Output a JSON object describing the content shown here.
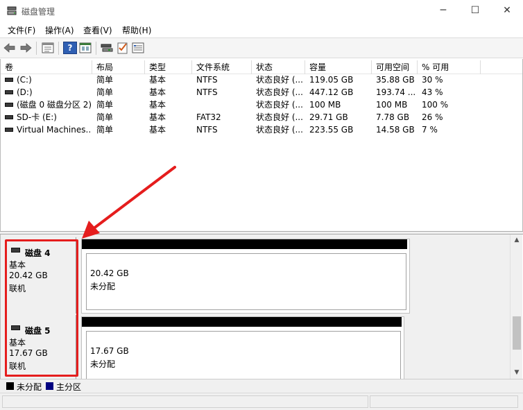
{
  "window": {
    "title": "磁盘管理",
    "minimize_glyph": "─",
    "maximize_glyph": "☐",
    "close_glyph": "✕"
  },
  "menu": [
    {
      "label": "文件(F)"
    },
    {
      "label": "操作(A)"
    },
    {
      "label": "查看(V)"
    },
    {
      "label": "帮助(H)"
    }
  ],
  "toolbar": {
    "icons": [
      "back-arrow-icon",
      "forward-arrow-icon",
      "console-view-icon",
      "help-icon",
      "properties-view-icon",
      "connect-icon",
      "checklist-icon",
      "settings-list-icon"
    ],
    "help_glyph": "?"
  },
  "volume_list": {
    "columns": [
      "卷",
      "布局",
      "类型",
      "文件系统",
      "状态",
      "容量",
      "可用空间",
      "% 可用"
    ],
    "rows": [
      {
        "name": "(C:)",
        "layout": "简单",
        "type": "基本",
        "fs": "NTFS",
        "status": "状态良好 (...",
        "capacity": "119.05 GB",
        "free": "35.88 GB",
        "pct": "30 %"
      },
      {
        "name": "(D:)",
        "layout": "简单",
        "type": "基本",
        "fs": "NTFS",
        "status": "状态良好 (...",
        "capacity": "447.12 GB",
        "free": "193.74 ...",
        "pct": "43 %"
      },
      {
        "name": "(磁盘 0 磁盘分区 2)",
        "layout": "简单",
        "type": "基本",
        "fs": "",
        "status": "状态良好 (...",
        "capacity": "100 MB",
        "free": "100 MB",
        "pct": "100 %"
      },
      {
        "name": "SD-卡 (E:)",
        "layout": "简单",
        "type": "基本",
        "fs": "FAT32",
        "status": "状态良好 (...",
        "capacity": "29.71 GB",
        "free": "7.78 GB",
        "pct": "26 %"
      },
      {
        "name": "Virtual Machines...",
        "layout": "简单",
        "type": "基本",
        "fs": "NTFS",
        "status": "状态良好 (...",
        "capacity": "223.55 GB",
        "free": "14.58 GB",
        "pct": "7 %"
      }
    ]
  },
  "disks": [
    {
      "name": "磁盘 4",
      "type": "基本",
      "size": "20.42 GB",
      "state": "联机",
      "partition_size": "20.42 GB",
      "partition_state": "未分配"
    },
    {
      "name": "磁盘 5",
      "type": "基本",
      "size": "17.67 GB",
      "state": "联机",
      "partition_size": "17.67 GB",
      "partition_state": "未分配"
    }
  ],
  "scrollbar": {
    "up_glyph": "▲",
    "down_glyph": "▼"
  },
  "legend": [
    {
      "label": "未分配",
      "color": "#000000"
    },
    {
      "label": "主分区",
      "color": "#000080"
    }
  ],
  "colors": {
    "annotation_red": "#e51d1d",
    "unallocated_bar": "#000000",
    "primary_partition": "#000080"
  }
}
